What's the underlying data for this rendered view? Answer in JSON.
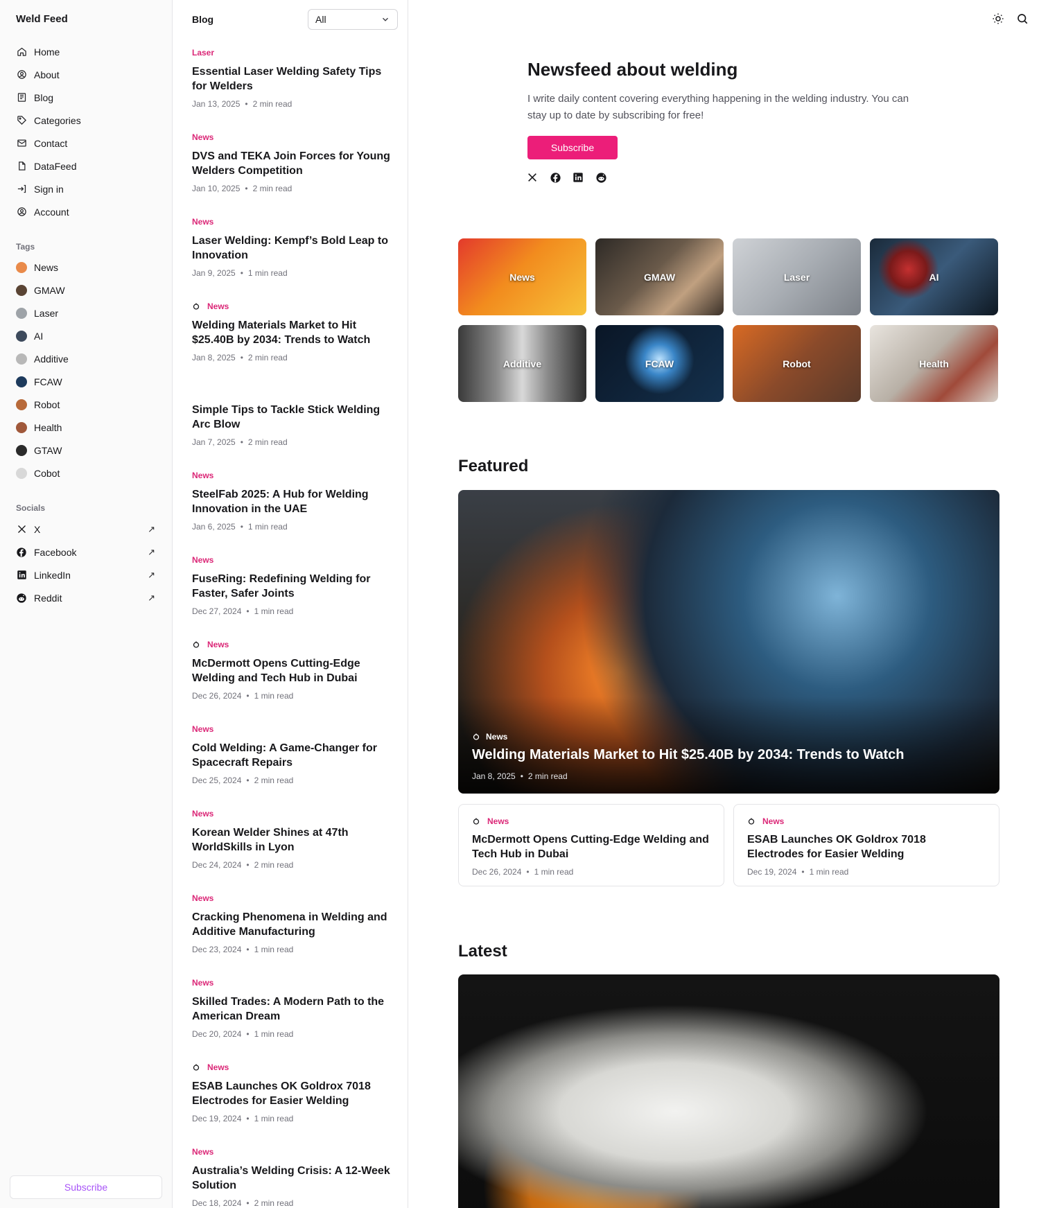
{
  "brand": "Weld Feed",
  "nav": [
    {
      "label": "Home",
      "icon": "home-icon"
    },
    {
      "label": "About",
      "icon": "user-circle-icon"
    },
    {
      "label": "Blog",
      "icon": "newspaper-icon"
    },
    {
      "label": "Categories",
      "icon": "tag-icon"
    },
    {
      "label": "Contact",
      "icon": "mail-icon"
    },
    {
      "label": "DataFeed",
      "icon": "file-icon"
    },
    {
      "label": "Sign in",
      "icon": "sign-in-icon"
    },
    {
      "label": "Account",
      "icon": "user-circle-icon"
    }
  ],
  "tags_label": "Tags",
  "tags": [
    {
      "label": "News",
      "color": "#e98a4a"
    },
    {
      "label": "GMAW",
      "color": "#5a4434"
    },
    {
      "label": "Laser",
      "color": "#9ea3a8"
    },
    {
      "label": "AI",
      "color": "#3d4a5c"
    },
    {
      "label": "Additive",
      "color": "#b8b8b8"
    },
    {
      "label": "FCAW",
      "color": "#1d3a5c"
    },
    {
      "label": "Robot",
      "color": "#b86a3a"
    },
    {
      "label": "Health",
      "color": "#a0583a"
    },
    {
      "label": "GTAW",
      "color": "#2a2a2a"
    },
    {
      "label": "Cobot",
      "color": "#d8d8d8"
    }
  ],
  "socials_label": "Socials",
  "socials": [
    {
      "label": "X",
      "icon": "x-icon"
    },
    {
      "label": "Facebook",
      "icon": "facebook-icon"
    },
    {
      "label": "LinkedIn",
      "icon": "linkedin-icon"
    },
    {
      "label": "Reddit",
      "icon": "reddit-icon"
    }
  ],
  "sidebar_subscribe": "Subscribe",
  "list": {
    "title": "Blog",
    "filter": "All",
    "posts": [
      {
        "tag": "Laser",
        "pinned": false,
        "title": "Essential Laser Welding Safety Tips for Welders",
        "date": "Jan 13, 2025",
        "read": "2 min read"
      },
      {
        "tag": "News",
        "pinned": false,
        "title": "DVS and TEKA Join Forces for Young Welders Competition",
        "date": "Jan 10, 2025",
        "read": "2 min read"
      },
      {
        "tag": "News",
        "pinned": false,
        "title": "Laser Welding: Kempf’s Bold Leap to Innovation",
        "date": "Jan 9, 2025",
        "read": "1 min read"
      },
      {
        "tag": "News",
        "pinned": true,
        "title": "Welding Materials Market to Hit $25.40B by 2034: Trends to Watch",
        "date": "Jan 8, 2025",
        "read": "2 min read"
      },
      {
        "tag": "",
        "pinned": false,
        "title": "Simple Tips to Tackle Stick Welding Arc Blow",
        "date": "Jan 7, 2025",
        "read": "2 min read"
      },
      {
        "tag": "News",
        "pinned": false,
        "title": "SteelFab 2025: A Hub for Welding Innovation in the UAE",
        "date": "Jan 6, 2025",
        "read": "1 min read"
      },
      {
        "tag": "News",
        "pinned": false,
        "title": "FuseRing: Redefining Welding for Faster, Safer Joints",
        "date": "Dec 27, 2024",
        "read": "1 min read"
      },
      {
        "tag": "News",
        "pinned": true,
        "title": "McDermott Opens Cutting-Edge Welding and Tech Hub in Dubai",
        "date": "Dec 26, 2024",
        "read": "1 min read"
      },
      {
        "tag": "News",
        "pinned": false,
        "title": "Cold Welding: A Game-Changer for Spacecraft Repairs",
        "date": "Dec 25, 2024",
        "read": "2 min read"
      },
      {
        "tag": "News",
        "pinned": false,
        "title": "Korean Welder Shines at 47th WorldSkills in Lyon",
        "date": "Dec 24, 2024",
        "read": "2 min read"
      },
      {
        "tag": "News",
        "pinned": false,
        "title": "Cracking Phenomena in Welding and Additive Manufacturing",
        "date": "Dec 23, 2024",
        "read": "1 min read"
      },
      {
        "tag": "News",
        "pinned": false,
        "title": "Skilled Trades: A Modern Path to the American Dream",
        "date": "Dec 20, 2024",
        "read": "1 min read"
      },
      {
        "tag": "News",
        "pinned": true,
        "title": "ESAB Launches OK Goldrox 7018 Electrodes for Easier Welding",
        "date": "Dec 19, 2024",
        "read": "1 min read"
      },
      {
        "tag": "News",
        "pinned": false,
        "title": "Australia’s Welding Crisis: A 12-Week Solution",
        "date": "Dec 18, 2024",
        "read": "2 min read"
      }
    ]
  },
  "hero": {
    "title": "Newsfeed about welding",
    "description": "I write daily content covering everything happening in the welding industry. You can stay up to date by subscribing for free!",
    "button": "Subscribe"
  },
  "categories": [
    {
      "label": "News",
      "bg": "linear-gradient(135deg,#e33a2c 0%,#f28c1e 45%,#f7c23a 100%)"
    },
    {
      "label": "GMAW",
      "bg": "linear-gradient(135deg,#2e2a26 0%,#6a5a4a 45%,#c0a080 70%,#3a3028 100%)"
    },
    {
      "label": "Laser",
      "bg": "linear-gradient(135deg,#cfd2d6 0%,#a8adb3 50%,#7c8188 100%)"
    },
    {
      "label": "AI",
      "bg": "radial-gradient(circle at 30% 40%,#c43030 0%,#7a1a1a 18%,transparent 30%),linear-gradient(135deg,#1a2a3a 0%,#3a5a7a 50%,#0e1822 100%)"
    },
    {
      "label": "Additive",
      "bg": "linear-gradient(90deg,#3a3a3a 0%,#8a8a8a 30%,#d8d8d8 50%,#8a8a8a 70%,#2e2e2e 100%)"
    },
    {
      "label": "FCAW",
      "bg": "radial-gradient(circle at 50% 45%,#bfe4ff 0%,#3a86c8 20%,transparent 45%),linear-gradient(135deg,#0a1626 0%,#14304c 100%)"
    },
    {
      "label": "Robot",
      "bg": "linear-gradient(135deg,#d86a24 0%,#8a4a2a 50%,#5a3a2a 100%)"
    },
    {
      "label": "Health",
      "bg": "linear-gradient(135deg,#e8e4de 0%,#b8b0a6 45%,#a04a3a 70%,#d8d2ca 100%)"
    }
  ],
  "featured": {
    "heading": "Featured",
    "main": {
      "tag": "News",
      "title": "Welding Materials Market to Hit $25.40B by 2034: Trends to Watch",
      "date": "Jan 8, 2025",
      "read": "2 min read"
    },
    "cards": [
      {
        "tag": "News",
        "title": "McDermott Opens Cutting-Edge Welding and Tech Hub in Dubai",
        "date": "Dec 26, 2024",
        "read": "1 min read"
      },
      {
        "tag": "News",
        "title": "ESAB Launches OK Goldrox 7018 Electrodes for Easier Welding",
        "date": "Dec 19, 2024",
        "read": "1 min read"
      }
    ]
  },
  "latest": {
    "heading": "Latest"
  },
  "colors": {
    "accent": "#ec1e79",
    "tag": "#db2777"
  }
}
